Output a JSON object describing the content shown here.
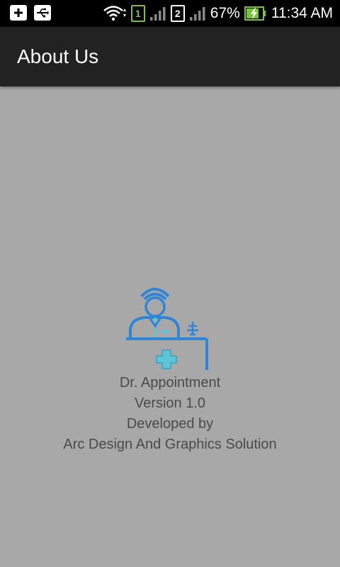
{
  "status_bar": {
    "battery_percent": "67%",
    "time": "11:34 AM",
    "sim1_label": "1",
    "sim2_label": "2",
    "icons": [
      "add-notification-icon",
      "usb-icon",
      "wifi-icon",
      "sim1-icon",
      "signal-icon",
      "sim2-icon",
      "signal-icon",
      "battery-charging-icon"
    ]
  },
  "app_bar": {
    "title": "About Us"
  },
  "about": {
    "app_name": "Dr. Appointment",
    "version": "Version 1.0",
    "developed_by": "Developed by",
    "developer": "Arc Design And Graphics Solution"
  },
  "colors": {
    "background": "#a8a8a8",
    "app_bar": "#222222",
    "text": "#4a4a4a",
    "logo_blue": "#2f86d6",
    "logo_cross": "#5cc6d6"
  }
}
